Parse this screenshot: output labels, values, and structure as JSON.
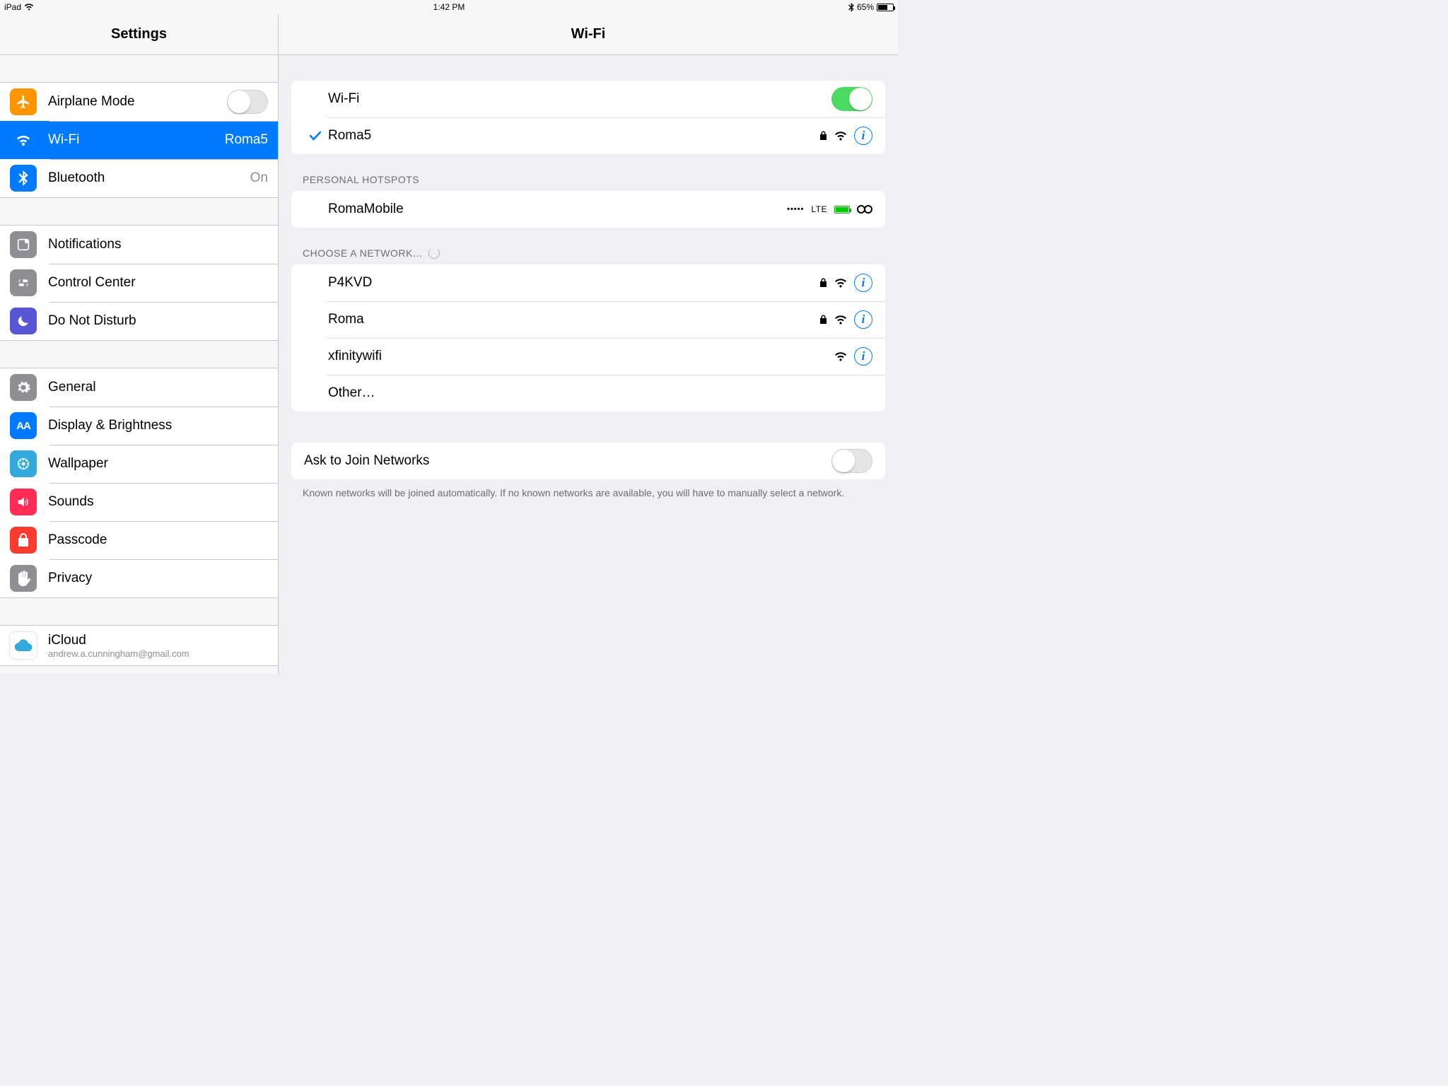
{
  "status": {
    "device": "iPad",
    "time": "1:42 PM",
    "battery_pct": "65%"
  },
  "sidebar": {
    "title": "Settings",
    "g1": [
      {
        "label": "Airplane Mode"
      },
      {
        "label": "Wi-Fi",
        "value": "Roma5"
      },
      {
        "label": "Bluetooth",
        "value": "On"
      }
    ],
    "g2": [
      {
        "label": "Notifications"
      },
      {
        "label": "Control Center"
      },
      {
        "label": "Do Not Disturb"
      }
    ],
    "g3": [
      {
        "label": "General"
      },
      {
        "label": "Display & Brightness"
      },
      {
        "label": "Wallpaper"
      },
      {
        "label": "Sounds"
      },
      {
        "label": "Passcode"
      },
      {
        "label": "Privacy"
      }
    ],
    "g4": [
      {
        "label": "iCloud",
        "sub": "andrew.a.cunningham@gmail.com"
      }
    ]
  },
  "detail": {
    "title": "Wi-Fi",
    "wifi_label": "Wi-Fi",
    "wifi_on": true,
    "connected": {
      "name": "Roma5"
    },
    "sec_hotspots": "Personal Hotspots",
    "hotspots": [
      {
        "name": "RomaMobile",
        "signal": "•••••",
        "carrier": "LTE"
      }
    ],
    "sec_choose": "Choose a Network…",
    "networks": [
      {
        "name": "P4KVD",
        "locked": true
      },
      {
        "name": "Roma",
        "locked": true
      },
      {
        "name": "xfinitywifi",
        "locked": false
      },
      {
        "name": "Other…",
        "other": true
      }
    ],
    "ask_label": "Ask to Join Networks",
    "ask_on": false,
    "ask_footer": "Known networks will be joined automatically. If no known networks are available, you will have to manually select a network."
  }
}
